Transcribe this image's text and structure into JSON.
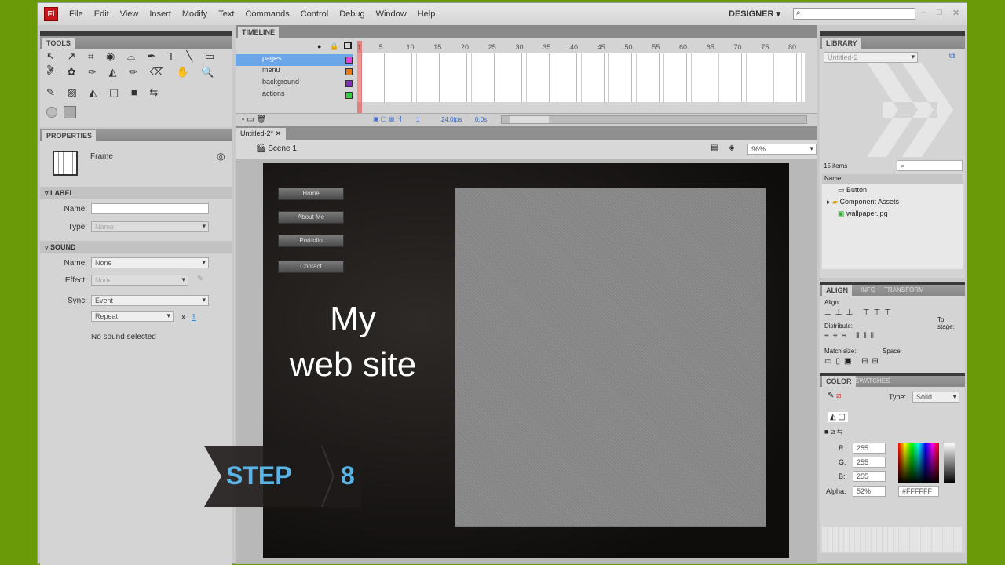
{
  "app": {
    "logo": "Fl",
    "menus": [
      "File",
      "Edit",
      "View",
      "Insert",
      "Modify",
      "Text",
      "Commands",
      "Control",
      "Debug",
      "Window",
      "Help"
    ],
    "workspace": "DESIGNER ▾",
    "window_controls": [
      "–",
      "□",
      "✕"
    ]
  },
  "tools": {
    "tab": "TOOLS",
    "row1": "↖ ↗ ⌗ ◉ ⌓ ✒ T ╲ ▭ ✎",
    "row2": "✐ ✿ ✑ ◭ ✏ ⌫ ✋ 🔍",
    "row3": "✎ ▨ ◭ ▢ ■ ⇆"
  },
  "properties": {
    "tab": "PROPERTIES",
    "kind": "Frame",
    "label_section": "LABEL",
    "name_label": "Name:",
    "name_value": "",
    "type_label": "Type:",
    "type_value": "Name",
    "sound_section": "SOUND",
    "sound_name_label": "Name:",
    "sound_name_value": "None",
    "effect_label": "Effect:",
    "effect_value": "None",
    "sync_label": "Sync:",
    "sync_value": "Event",
    "repeat_value": "Repeat",
    "repeat_x": "x",
    "repeat_count": "1",
    "status": "No sound selected"
  },
  "timeline": {
    "tab": "TIMELINE",
    "layers": [
      {
        "name": "pages",
        "color": "#e040e0",
        "selected": true
      },
      {
        "name": "menu",
        "color": "#e87810"
      },
      {
        "name": "background",
        "color": "#8030c0",
        "locked": true
      },
      {
        "name": "actions",
        "color": "#30d040"
      }
    ],
    "frame_numbers": [
      1,
      5,
      10,
      15,
      20,
      25,
      30,
      35,
      40,
      45,
      50,
      55,
      60,
      65,
      70,
      75,
      80
    ],
    "current_frame": "1",
    "fps": "24.0fps",
    "time": "0.0s"
  },
  "document": {
    "tab": "Untitled-2*",
    "close": "✕",
    "scene": "Scene 1",
    "zoom": "96%"
  },
  "stage": {
    "nav": [
      "Home",
      "About Me",
      "Portfolio",
      "Contact"
    ],
    "title_line1": "My",
    "title_line2": "web site"
  },
  "library": {
    "tab": "LIBRARY",
    "document": "Untitled-2",
    "count": "15 items",
    "column": "Name",
    "items": [
      {
        "name": "Button",
        "icon": "button-symbol-icon"
      },
      {
        "name": "Component Assets",
        "icon": "folder-icon"
      },
      {
        "name": "wallpaper.jpg",
        "icon": "bitmap-icon"
      }
    ]
  },
  "align": {
    "tabs": [
      "ALIGN",
      "INFO",
      "TRANSFORM"
    ],
    "align": "Align:",
    "distribute": "Distribute:",
    "match": "Match size:",
    "space": "Space:",
    "to_stage": "To stage:"
  },
  "color": {
    "tabs": [
      "COLOR",
      "SWATCHES"
    ],
    "type_label": "Type:",
    "type_value": "Solid",
    "r": "255",
    "g": "255",
    "b": "255",
    "alpha": "52%",
    "hex": "#FFFFFF"
  },
  "overlay": {
    "step_label": "STEP",
    "step_number": "8",
    "accent": "#5ab4e6"
  }
}
